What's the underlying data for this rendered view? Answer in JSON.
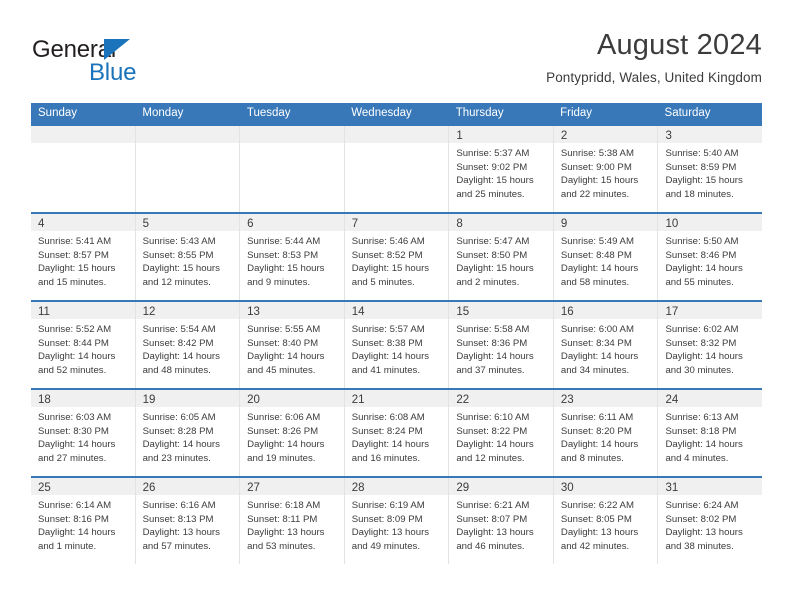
{
  "brand": {
    "name_top": "General",
    "name_bottom": "Blue",
    "triangle_color": "#1b74bb",
    "text_color": "#231f20"
  },
  "header": {
    "title": "August 2024",
    "subtitle": "Pontypridd, Wales, United Kingdom"
  },
  "theme": {
    "header_blue": "#3878b8",
    "day_strip_gray": "#f0f0f0",
    "text_gray": "#3c3c3c"
  },
  "weekdays": [
    "Sunday",
    "Monday",
    "Tuesday",
    "Wednesday",
    "Thursday",
    "Friday",
    "Saturday"
  ],
  "weeks": [
    [
      {
        "day": "",
        "sunrise": "",
        "sunset": "",
        "daylight1": "",
        "daylight2": ""
      },
      {
        "day": "",
        "sunrise": "",
        "sunset": "",
        "daylight1": "",
        "daylight2": ""
      },
      {
        "day": "",
        "sunrise": "",
        "sunset": "",
        "daylight1": "",
        "daylight2": ""
      },
      {
        "day": "",
        "sunrise": "",
        "sunset": "",
        "daylight1": "",
        "daylight2": ""
      },
      {
        "day": "1",
        "sunrise": "Sunrise: 5:37 AM",
        "sunset": "Sunset: 9:02 PM",
        "daylight1": "Daylight: 15 hours",
        "daylight2": "and 25 minutes."
      },
      {
        "day": "2",
        "sunrise": "Sunrise: 5:38 AM",
        "sunset": "Sunset: 9:00 PM",
        "daylight1": "Daylight: 15 hours",
        "daylight2": "and 22 minutes."
      },
      {
        "day": "3",
        "sunrise": "Sunrise: 5:40 AM",
        "sunset": "Sunset: 8:59 PM",
        "daylight1": "Daylight: 15 hours",
        "daylight2": "and 18 minutes."
      }
    ],
    [
      {
        "day": "4",
        "sunrise": "Sunrise: 5:41 AM",
        "sunset": "Sunset: 8:57 PM",
        "daylight1": "Daylight: 15 hours",
        "daylight2": "and 15 minutes."
      },
      {
        "day": "5",
        "sunrise": "Sunrise: 5:43 AM",
        "sunset": "Sunset: 8:55 PM",
        "daylight1": "Daylight: 15 hours",
        "daylight2": "and 12 minutes."
      },
      {
        "day": "6",
        "sunrise": "Sunrise: 5:44 AM",
        "sunset": "Sunset: 8:53 PM",
        "daylight1": "Daylight: 15 hours",
        "daylight2": "and 9 minutes."
      },
      {
        "day": "7",
        "sunrise": "Sunrise: 5:46 AM",
        "sunset": "Sunset: 8:52 PM",
        "daylight1": "Daylight: 15 hours",
        "daylight2": "and 5 minutes."
      },
      {
        "day": "8",
        "sunrise": "Sunrise: 5:47 AM",
        "sunset": "Sunset: 8:50 PM",
        "daylight1": "Daylight: 15 hours",
        "daylight2": "and 2 minutes."
      },
      {
        "day": "9",
        "sunrise": "Sunrise: 5:49 AM",
        "sunset": "Sunset: 8:48 PM",
        "daylight1": "Daylight: 14 hours",
        "daylight2": "and 58 minutes."
      },
      {
        "day": "10",
        "sunrise": "Sunrise: 5:50 AM",
        "sunset": "Sunset: 8:46 PM",
        "daylight1": "Daylight: 14 hours",
        "daylight2": "and 55 minutes."
      }
    ],
    [
      {
        "day": "11",
        "sunrise": "Sunrise: 5:52 AM",
        "sunset": "Sunset: 8:44 PM",
        "daylight1": "Daylight: 14 hours",
        "daylight2": "and 52 minutes."
      },
      {
        "day": "12",
        "sunrise": "Sunrise: 5:54 AM",
        "sunset": "Sunset: 8:42 PM",
        "daylight1": "Daylight: 14 hours",
        "daylight2": "and 48 minutes."
      },
      {
        "day": "13",
        "sunrise": "Sunrise: 5:55 AM",
        "sunset": "Sunset: 8:40 PM",
        "daylight1": "Daylight: 14 hours",
        "daylight2": "and 45 minutes."
      },
      {
        "day": "14",
        "sunrise": "Sunrise: 5:57 AM",
        "sunset": "Sunset: 8:38 PM",
        "daylight1": "Daylight: 14 hours",
        "daylight2": "and 41 minutes."
      },
      {
        "day": "15",
        "sunrise": "Sunrise: 5:58 AM",
        "sunset": "Sunset: 8:36 PM",
        "daylight1": "Daylight: 14 hours",
        "daylight2": "and 37 minutes."
      },
      {
        "day": "16",
        "sunrise": "Sunrise: 6:00 AM",
        "sunset": "Sunset: 8:34 PM",
        "daylight1": "Daylight: 14 hours",
        "daylight2": "and 34 minutes."
      },
      {
        "day": "17",
        "sunrise": "Sunrise: 6:02 AM",
        "sunset": "Sunset: 8:32 PM",
        "daylight1": "Daylight: 14 hours",
        "daylight2": "and 30 minutes."
      }
    ],
    [
      {
        "day": "18",
        "sunrise": "Sunrise: 6:03 AM",
        "sunset": "Sunset: 8:30 PM",
        "daylight1": "Daylight: 14 hours",
        "daylight2": "and 27 minutes."
      },
      {
        "day": "19",
        "sunrise": "Sunrise: 6:05 AM",
        "sunset": "Sunset: 8:28 PM",
        "daylight1": "Daylight: 14 hours",
        "daylight2": "and 23 minutes."
      },
      {
        "day": "20",
        "sunrise": "Sunrise: 6:06 AM",
        "sunset": "Sunset: 8:26 PM",
        "daylight1": "Daylight: 14 hours",
        "daylight2": "and 19 minutes."
      },
      {
        "day": "21",
        "sunrise": "Sunrise: 6:08 AM",
        "sunset": "Sunset: 8:24 PM",
        "daylight1": "Daylight: 14 hours",
        "daylight2": "and 16 minutes."
      },
      {
        "day": "22",
        "sunrise": "Sunrise: 6:10 AM",
        "sunset": "Sunset: 8:22 PM",
        "daylight1": "Daylight: 14 hours",
        "daylight2": "and 12 minutes."
      },
      {
        "day": "23",
        "sunrise": "Sunrise: 6:11 AM",
        "sunset": "Sunset: 8:20 PM",
        "daylight1": "Daylight: 14 hours",
        "daylight2": "and 8 minutes."
      },
      {
        "day": "24",
        "sunrise": "Sunrise: 6:13 AM",
        "sunset": "Sunset: 8:18 PM",
        "daylight1": "Daylight: 14 hours",
        "daylight2": "and 4 minutes."
      }
    ],
    [
      {
        "day": "25",
        "sunrise": "Sunrise: 6:14 AM",
        "sunset": "Sunset: 8:16 PM",
        "daylight1": "Daylight: 14 hours",
        "daylight2": "and 1 minute."
      },
      {
        "day": "26",
        "sunrise": "Sunrise: 6:16 AM",
        "sunset": "Sunset: 8:13 PM",
        "daylight1": "Daylight: 13 hours",
        "daylight2": "and 57 minutes."
      },
      {
        "day": "27",
        "sunrise": "Sunrise: 6:18 AM",
        "sunset": "Sunset: 8:11 PM",
        "daylight1": "Daylight: 13 hours",
        "daylight2": "and 53 minutes."
      },
      {
        "day": "28",
        "sunrise": "Sunrise: 6:19 AM",
        "sunset": "Sunset: 8:09 PM",
        "daylight1": "Daylight: 13 hours",
        "daylight2": "and 49 minutes."
      },
      {
        "day": "29",
        "sunrise": "Sunrise: 6:21 AM",
        "sunset": "Sunset: 8:07 PM",
        "daylight1": "Daylight: 13 hours",
        "daylight2": "and 46 minutes."
      },
      {
        "day": "30",
        "sunrise": "Sunrise: 6:22 AM",
        "sunset": "Sunset: 8:05 PM",
        "daylight1": "Daylight: 13 hours",
        "daylight2": "and 42 minutes."
      },
      {
        "day": "31",
        "sunrise": "Sunrise: 6:24 AM",
        "sunset": "Sunset: 8:02 PM",
        "daylight1": "Daylight: 13 hours",
        "daylight2": "and 38 minutes."
      }
    ]
  ]
}
